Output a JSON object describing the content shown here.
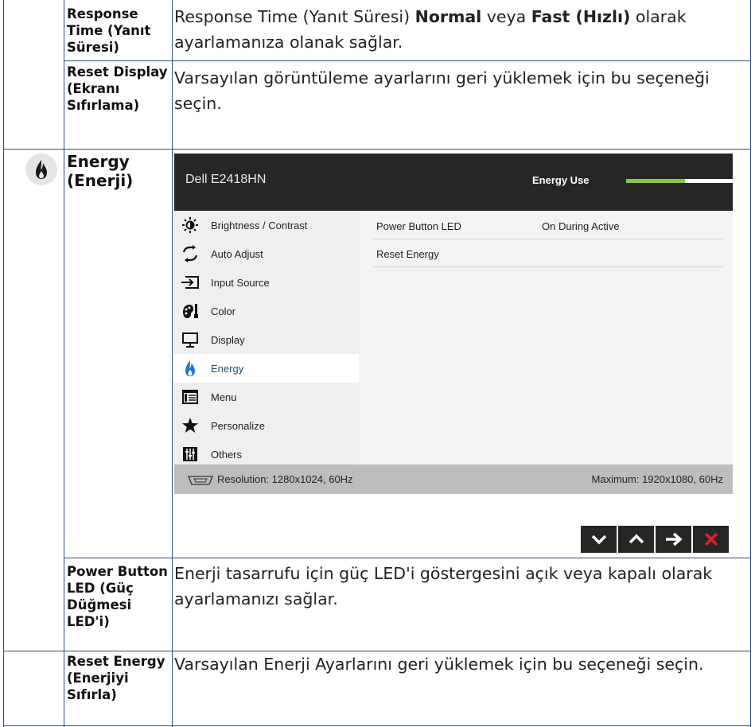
{
  "rows": {
    "response_time": {
      "label": "Response Time (Yanıt Süresi)",
      "desc_pre": "Response Time (Yanıt Süresi) ",
      "desc_bold1": "Normal",
      "desc_mid": " veya ",
      "desc_bold2": "Fast (Hızlı)",
      "desc_post": " olarak ayarlamanıza olanak sağlar."
    },
    "reset_display": {
      "label": "Reset Display (Ekranı Sıfırlama)",
      "desc": "Varsayılan görüntüleme ayarlarını geri yüklemek için bu seçeneği seçin."
    },
    "energy": {
      "label": "Energy (Enerji)",
      "icon": "flame-icon"
    },
    "power_led": {
      "label": "Power Button LED (Güç Düğmesi LED'i)",
      "desc": "Enerji tasarrufu için güç LED'i göstergesini açık veya kapalı olarak ayarlamanızı sağlar."
    },
    "reset_energy": {
      "label": "Reset Energy (Enerjiyi Sıfırla)",
      "desc": "Varsayılan Enerji Ayarlarını geri yüklemek için bu seçeneği seçin."
    }
  },
  "osd": {
    "model": "Dell E2418HN",
    "energy_use_label": "Energy Use",
    "energy_use_level": 0.55,
    "menu": [
      {
        "label": "Brightness / Contrast",
        "icon": "brightness-icon"
      },
      {
        "label": "Auto Adjust",
        "icon": "auto-adjust-icon"
      },
      {
        "label": "Input Source",
        "icon": "input-source-icon"
      },
      {
        "label": "Color",
        "icon": "color-icon"
      },
      {
        "label": "Display",
        "icon": "display-icon"
      },
      {
        "label": "Energy",
        "icon": "energy-icon",
        "active": true
      },
      {
        "label": "Menu",
        "icon": "menu-icon"
      },
      {
        "label": "Personalize",
        "icon": "star-icon"
      },
      {
        "label": "Others",
        "icon": "others-icon"
      }
    ],
    "detail": [
      {
        "name": "Power Button LED",
        "value": "On During Active"
      },
      {
        "name": "Reset Energy",
        "value": ""
      }
    ],
    "footer": {
      "resolution": "Resolution: 1280x1024, 60Hz",
      "maximum": "Maximum: 1920x1080, 60Hz"
    },
    "nav": [
      "chevron-down-icon",
      "chevron-up-icon",
      "arrow-right-icon",
      "close-icon"
    ]
  },
  "colors": {
    "table_border": "#2e4d7a",
    "osd_header": "#262626",
    "energy_bar": "#8cc63e",
    "active_menu_text": "#1f4e79",
    "close_red": "#e0202a"
  }
}
